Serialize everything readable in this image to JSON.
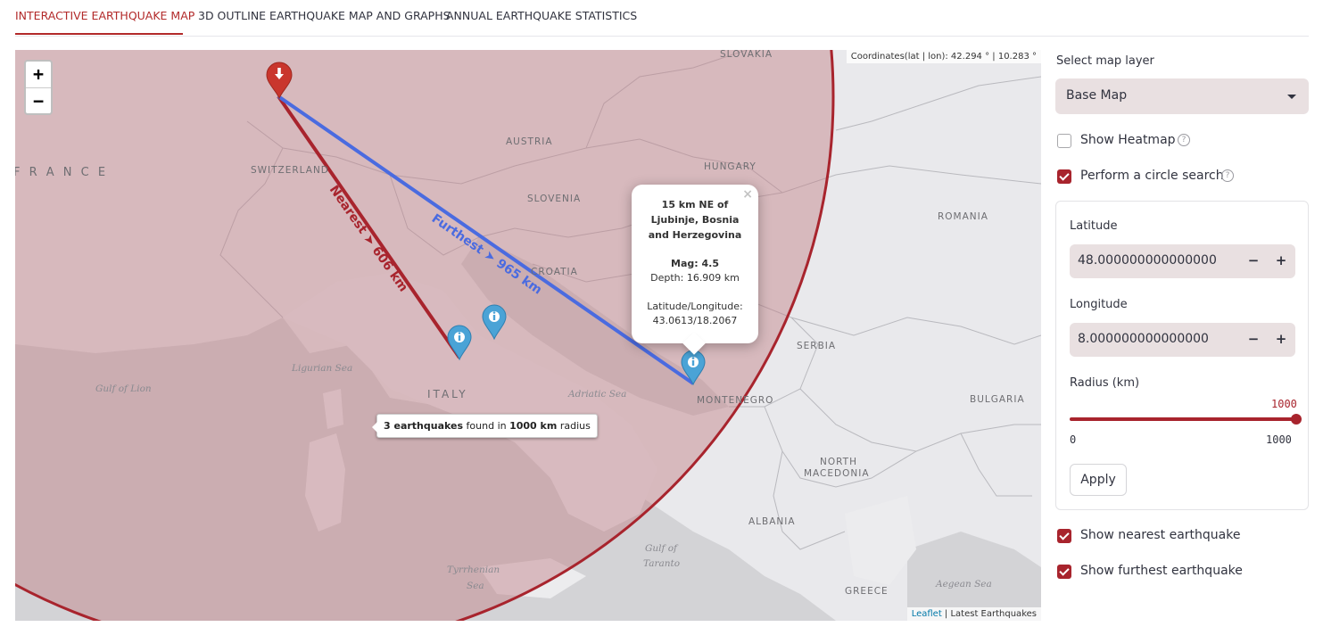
{
  "tabs": [
    {
      "label": "INTERACTIVE EARTHQUAKE MAP",
      "active": true
    },
    {
      "label": "3D OUTLINE EARTHQUAKE MAP AND GRAPHS",
      "active": false
    },
    {
      "label": "ANNUAL EARTHQUAKE STATISTICS",
      "active": false
    }
  ],
  "map": {
    "zoom_in": "+",
    "zoom_out": "−",
    "coordinates": "Coordinates(lat | lon): 42.294 ° | 10.283 °",
    "attribution_link": "Leaflet",
    "attribution_text": " | Latest Earthquakes",
    "colors": {
      "circle_fill": "#d9a7aa",
      "circle_stroke": "#a8242d",
      "nearest_line": "#a8242d",
      "furthest_line": "#4a6be0",
      "marker_blue": "#4aa3d6",
      "marker_red": "#c9362d"
    },
    "countries": {
      "slovakia": "SLOVAKIA",
      "austria": "AUSTRIA",
      "hungary": "HUNGARY",
      "france": "F R A N C E",
      "switzerland": "SWITZERLAND",
      "slovenia": "SLOVENIA",
      "romania": "ROMANIA",
      "croatia": "CROATIA",
      "serbia": "SERBIA",
      "italy": "ITALY",
      "montenegro": "MONTENEGRO",
      "bulgaria": "BULGARIA",
      "north": "NORTH",
      "macedonia": "MACEDONIA",
      "albania": "ALBANIA",
      "greece": "GREECE"
    },
    "seas": {
      "ligurian": "Ligurian Sea",
      "gulf_lion": "Gulf of Lion",
      "adriatic": "Adriatic Sea",
      "gulf_of": "Gulf of",
      "taranto": "Taranto",
      "tyrrhenian": "Tyrrhenian",
      "sea": "Sea",
      "aegean": "Aegean Sea"
    },
    "nearest_label": "Nearest ➤ 606 km",
    "furthest_label": "Furthest ➤ 965 km",
    "popup": {
      "title_line1": "15 km NE of",
      "title_line2": "Ljubinje, Bosnia",
      "title_line3": "and Herzegovina",
      "mag": "Mag: 4.5",
      "depth": "Depth: 16.909 km",
      "latlon_label": "Latitude/Longitude:",
      "latlon_value": "43.0613/18.2067",
      "close": "×"
    },
    "tooltip": {
      "count": "3 earthquakes",
      "mid": " found in ",
      "radius": "1000 km",
      "end": " radius"
    }
  },
  "sidebar": {
    "layer_label": "Select map layer",
    "layer_value": "Base Map",
    "heatmap_label": "Show Heatmap",
    "heatmap_checked": false,
    "circle_label": "Perform a circle search",
    "circle_checked": true,
    "help": "?",
    "latitude_label": "Latitude",
    "latitude_value": "48.000000000000000",
    "longitude_label": "Longitude",
    "longitude_value": "8.000000000000000",
    "stepper_minus": "−",
    "stepper_plus": "+",
    "radius_label": "Radius (km)",
    "radius_value": "1000",
    "radius_min": "0",
    "radius_max": "1000",
    "radius_fraction": 1.0,
    "apply_label": "Apply",
    "nearest_label": "Show nearest earthquake",
    "nearest_checked": true,
    "furthest_label": "Show furthest earthquake",
    "furthest_checked": true
  }
}
